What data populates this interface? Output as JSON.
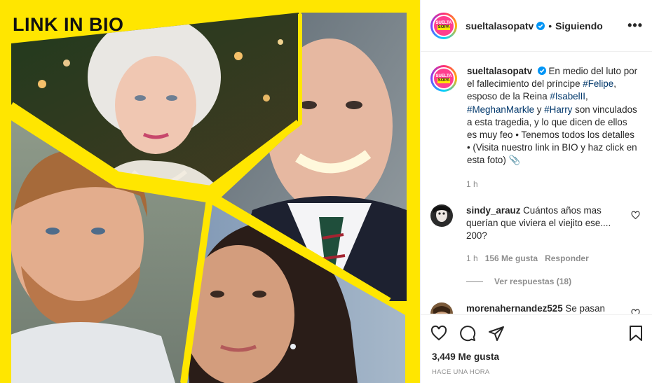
{
  "media": {
    "banner_text": "LINK IN BIO",
    "colors": {
      "background": "#ffe600"
    }
  },
  "account": {
    "avatar_text_line1": "SUELTA",
    "avatar_text_line2": "SOPA",
    "username": "sueltalasopatv",
    "separator": "•",
    "follow_status": "Siguiendo",
    "more_icon": "•••"
  },
  "caption": {
    "username": "sueltalasopatv",
    "text_1": "En medio del luto por el fallecimiento del príncipe",
    "tag_felipe": "#Felipe",
    "text_2": ", esposo de la Reina",
    "tag_isabel": "#IsabelII",
    "text_3": ",",
    "tag_meghan": "#MeghanMarkle",
    "text_4": "y",
    "tag_harry": "#Harry",
    "text_5": "son vinculados a esta tragedia, y lo que dicen de ellos es muy feo • Tenemos todos los detalles • (Visita nuestro link in BIO y haz click en esta foto) 📎",
    "timestamp": "1 h"
  },
  "comments": [
    {
      "username": "sindy_arauz",
      "text": "Cuántos años mas querían que viviera el viejito ese.... 200?",
      "time": "1 h",
      "likes": "156 Me gusta",
      "reply_label": "Responder",
      "view_replies": "Ver respuestas (18)"
    },
    {
      "username": "morenahernandez525",
      "text": "Se pasan"
    }
  ],
  "actions": {
    "likes": "3,449 Me gusta",
    "posted": "HACE UNA HORA"
  },
  "colors": {
    "link": "#00376b",
    "muted": "#8e8e8e",
    "verified": "#0095f6"
  }
}
